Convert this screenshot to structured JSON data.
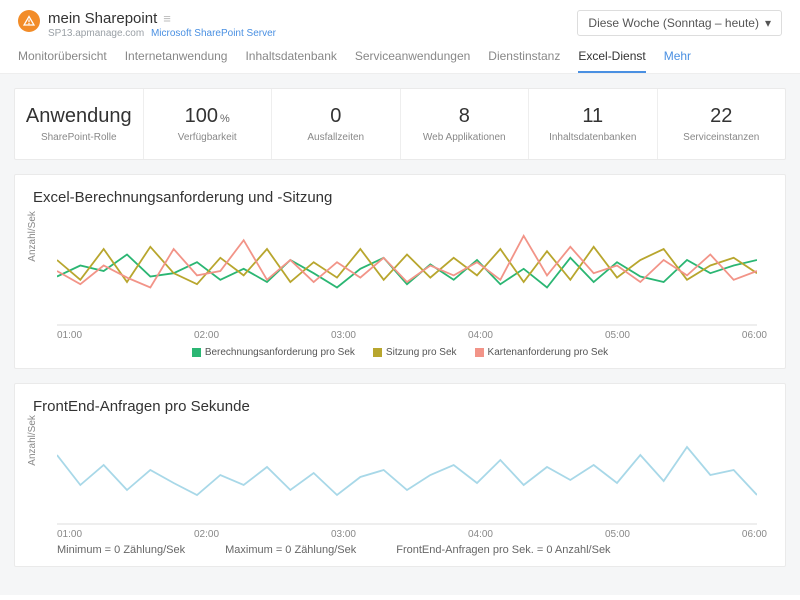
{
  "header": {
    "title": "mein Sharepoint",
    "subdomain": "SP13.apmanage.com",
    "server_link": "Microsoft SharePoint Server",
    "range_label": "Diese Woche (Sonntag – heute)"
  },
  "tabs": {
    "items": [
      {
        "label": "Monitorübersicht"
      },
      {
        "label": "Internetanwendung"
      },
      {
        "label": "Inhaltsdatenbank"
      },
      {
        "label": "Serviceanwendungen"
      },
      {
        "label": "Dienstinstanz"
      },
      {
        "label": "Excel-Dienst"
      }
    ],
    "more": "Mehr",
    "active_index": 5
  },
  "metrics": [
    {
      "value": "Anwendung",
      "label": "SharePoint-Rolle"
    },
    {
      "value": "100",
      "unit": "%",
      "label": "Verfügbarkeit"
    },
    {
      "value": "0",
      "label": "Ausfallzeiten"
    },
    {
      "value": "8",
      "label": "Web Applikationen"
    },
    {
      "value": "11",
      "label": "Inhaltsdatenbanken"
    },
    {
      "value": "22",
      "label": "Serviceinstanzen"
    }
  ],
  "chart1": {
    "title": "Excel-Berechnungsanforderung und -Sitzung",
    "ylabel": "Anzahl/Sek",
    "legend": [
      {
        "name": "Berechnungsanforderung pro Sek",
        "color": "#2bb673"
      },
      {
        "name": "Sitzung pro Sek",
        "color": "#b8a62e"
      },
      {
        "name": "Kartenanforderung pro Sek",
        "color": "#f29488"
      }
    ]
  },
  "chart2": {
    "title": "FrontEnd-Anfragen pro Sekunde",
    "ylabel": "Anzahl/Sek",
    "color": "#a8d8e8",
    "footnote": {
      "min": "Minimum = 0 Zählung/Sek",
      "max": "Maximum = 0 Zählung/Sek",
      "avg": "FrontEnd-Anfragen pro Sek. = 0 Anzahl/Sek"
    }
  },
  "xticks": [
    "01:00",
    "02:00",
    "03:00",
    "04:00",
    "05:00",
    "06:00"
  ],
  "chart_data": [
    {
      "type": "line",
      "title": "Excel-Berechnungsanforderung und -Sitzung",
      "ylabel": "Anzahl/Sek",
      "x": [
        "01:00",
        "01:10",
        "01:20",
        "01:30",
        "01:40",
        "01:50",
        "02:00",
        "02:10",
        "02:20",
        "02:30",
        "02:40",
        "02:50",
        "03:00",
        "03:10",
        "03:20",
        "03:30",
        "03:40",
        "03:50",
        "04:00",
        "04:10",
        "04:20",
        "04:30",
        "04:40",
        "04:50",
        "05:00",
        "05:10",
        "05:20",
        "05:30",
        "05:40",
        "05:50",
        "06:00"
      ],
      "series": [
        {
          "name": "Berechnungsanforderung pro Sek",
          "color": "#2bb673",
          "values": [
            45,
            55,
            50,
            65,
            45,
            48,
            58,
            42,
            52,
            40,
            60,
            48,
            35,
            52,
            62,
            38,
            56,
            42,
            60,
            38,
            52,
            35,
            62,
            40,
            58,
            45,
            40,
            60,
            48,
            55,
            60
          ]
        },
        {
          "name": "Sitzung pro Sek",
          "color": "#b8a62e",
          "values": [
            60,
            42,
            70,
            40,
            72,
            48,
            38,
            62,
            46,
            70,
            40,
            58,
            44,
            70,
            42,
            65,
            44,
            62,
            46,
            70,
            40,
            68,
            42,
            72,
            44,
            60,
            70,
            42,
            55,
            62,
            48
          ]
        },
        {
          "name": "Kartenanforderung pro Sek",
          "color": "#f29488",
          "values": [
            50,
            38,
            55,
            44,
            35,
            70,
            46,
            50,
            78,
            42,
            60,
            40,
            58,
            44,
            62,
            40,
            55,
            46,
            58,
            42,
            82,
            46,
            72,
            48,
            55,
            40,
            60,
            46,
            65,
            42,
            50
          ]
        }
      ],
      "ylim": [
        0,
        100
      ]
    },
    {
      "type": "line",
      "title": "FrontEnd-Anfragen pro Sekunde",
      "ylabel": "Anzahl/Sek",
      "x": [
        "01:00",
        "01:10",
        "01:20",
        "01:30",
        "01:40",
        "01:50",
        "02:00",
        "02:10",
        "02:20",
        "02:30",
        "02:40",
        "02:50",
        "03:00",
        "03:10",
        "03:20",
        "03:30",
        "03:40",
        "03:50",
        "04:00",
        "04:10",
        "04:20",
        "04:30",
        "04:40",
        "04:50",
        "05:00",
        "05:10",
        "05:20",
        "05:30",
        "05:40",
        "05:50",
        "06:00"
      ],
      "series": [
        {
          "name": "FrontEnd-Anfragen pro Sek",
          "color": "#a8d8e8",
          "values": [
            70,
            40,
            60,
            35,
            55,
            42,
            30,
            50,
            40,
            58,
            35,
            52,
            30,
            48,
            55,
            35,
            50,
            60,
            42,
            65,
            40,
            58,
            45,
            60,
            42,
            70,
            44,
            78,
            50,
            55,
            30
          ]
        }
      ],
      "ylim": [
        0,
        100
      ],
      "annotations": {
        "min": 0,
        "max": 0,
        "rate": 0
      }
    }
  ]
}
